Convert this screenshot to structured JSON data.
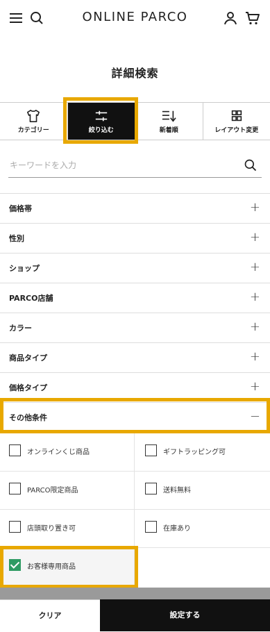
{
  "header": {
    "logo": "ONLINE PARCO"
  },
  "page_title": "詳細検索",
  "tabs": [
    {
      "label": "カテゴリー",
      "icon": "tshirt-icon"
    },
    {
      "label": "絞り込む",
      "icon": "filter-sliders-icon",
      "active": true
    },
    {
      "label": "新着順",
      "icon": "sort-icon"
    },
    {
      "label": "レイアウト変更",
      "icon": "grid-icon"
    }
  ],
  "search": {
    "placeholder": "キーワードを入力",
    "value": ""
  },
  "accordion": [
    {
      "label": "価格帯",
      "state": "+"
    },
    {
      "label": "性別",
      "state": "+"
    },
    {
      "label": "ショップ",
      "state": "+"
    },
    {
      "label": "PARCO店舗",
      "state": "+"
    },
    {
      "label": "カラー",
      "state": "+"
    },
    {
      "label": "商品タイプ",
      "state": "+"
    },
    {
      "label": "価格タイプ",
      "state": "+"
    },
    {
      "label": "その他条件",
      "state": "−"
    }
  ],
  "options": [
    {
      "label": "オンラインくじ商品",
      "checked": false
    },
    {
      "label": "ギフトラッピング可",
      "checked": false
    },
    {
      "label": "PARCO限定商品",
      "checked": false
    },
    {
      "label": "送料無料",
      "checked": false
    },
    {
      "label": "店頭取り置き可",
      "checked": false
    },
    {
      "label": "在庫あり",
      "checked": false
    },
    {
      "label": "お客様専用商品",
      "checked": true
    }
  ],
  "bottom": {
    "clear_label": "クリア",
    "apply_label": "設定する"
  },
  "colors": {
    "highlight": "#e8a800",
    "check_green": "#2e9b63",
    "dark": "#111111"
  }
}
